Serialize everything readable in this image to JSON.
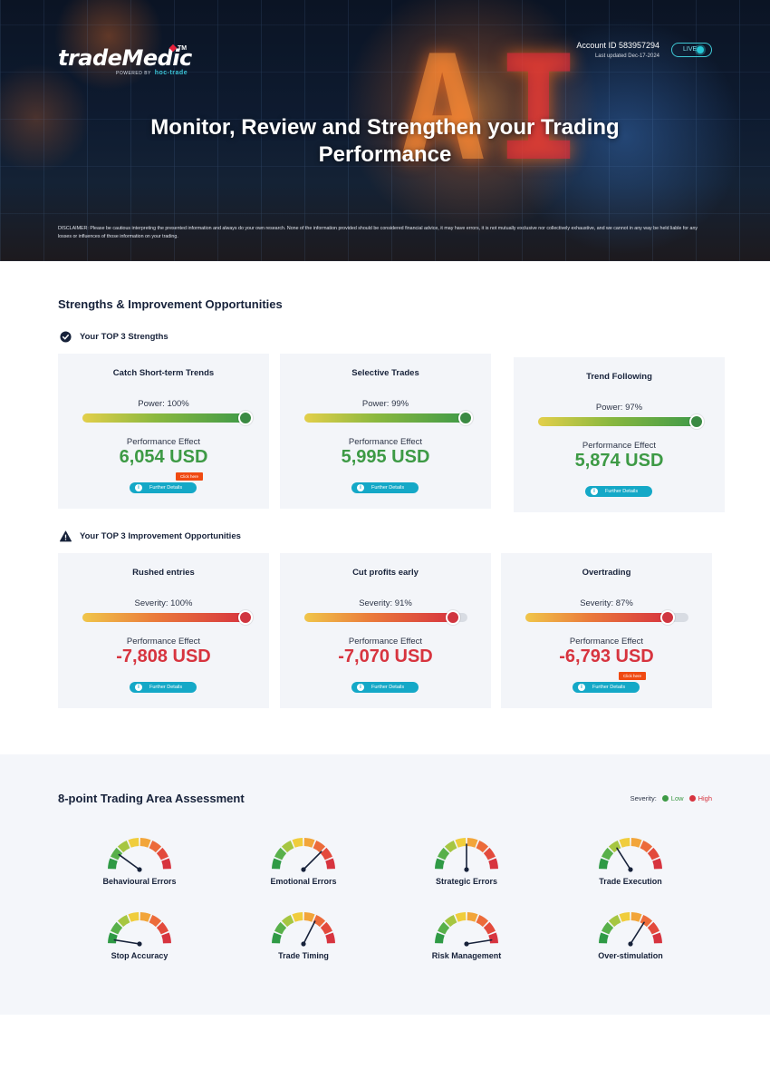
{
  "header": {
    "brand": "tradeMedic",
    "trademark": "TM",
    "powered_by": "POWERED BY",
    "powered_brand": "hoc-trade",
    "account_id": "Account ID 583957294",
    "last_updated": "Last updated Dec-17-2024",
    "live_label": "LIVE",
    "title_line1": "Monitor, Review and Strengthen your Trading",
    "title_line2": "Performance",
    "disclaimer": "DISCLAIMER: Please be cautious interpreting the presented information and always do your own research. None of the information provided should be considered financial advice, it may have errors, it is not mutually exclusive nor collectively exhaustive, and we cannot in any way be held liable for any losses or influences of those information on your trading."
  },
  "strengths_section": {
    "title": "Strengths & Improvement Opportunities",
    "strengths_title": "Your TOP 3 Strengths",
    "improvements_title": "Your TOP 3 Improvement Opportunities",
    "effect_label": "Performance Effect",
    "details_label": "Further Details",
    "click_here": "Click here",
    "strengths": [
      {
        "title": "Catch Short-term Trends",
        "metric": "Power: 100%",
        "level": 1.0,
        "value": "6,054 USD"
      },
      {
        "title": "Selective Trades",
        "metric": "Power: 99%",
        "level": 0.99,
        "value": "5,995 USD"
      },
      {
        "title": "Trend Following",
        "metric": "Power: 97%",
        "level": 0.97,
        "value": "5,874 USD"
      }
    ],
    "improvements": [
      {
        "title": "Rushed entries",
        "metric": "Severity: 100%",
        "level": 1.0,
        "value": "-7,808 USD"
      },
      {
        "title": "Cut profits early",
        "metric": "Severity: 91%",
        "level": 0.91,
        "value": "-7,070 USD"
      },
      {
        "title": "Overtrading",
        "metric": "Severity: 87%",
        "level": 0.87,
        "value": "-6,793 USD"
      }
    ]
  },
  "assessment": {
    "title": "8-point Trading Area Assessment",
    "legend_label": "Severity:",
    "legend_low": "Low",
    "legend_high": "High",
    "colors": {
      "low": "#3d9a45",
      "high": "#d7343f"
    },
    "gauges": [
      {
        "label": "Behavioural Errors",
        "level": 0.2
      },
      {
        "label": "Emotional Errors",
        "level": 0.75
      },
      {
        "label": "Strategic Errors",
        "level": 0.5
      },
      {
        "label": "Trade Execution",
        "level": 0.32
      },
      {
        "label": "Stop Accuracy",
        "level": 0.05
      },
      {
        "label": "Trade Timing",
        "level": 0.65
      },
      {
        "label": "Risk Management",
        "level": 0.95
      },
      {
        "label": "Over-stimulation",
        "level": 0.68
      }
    ]
  }
}
